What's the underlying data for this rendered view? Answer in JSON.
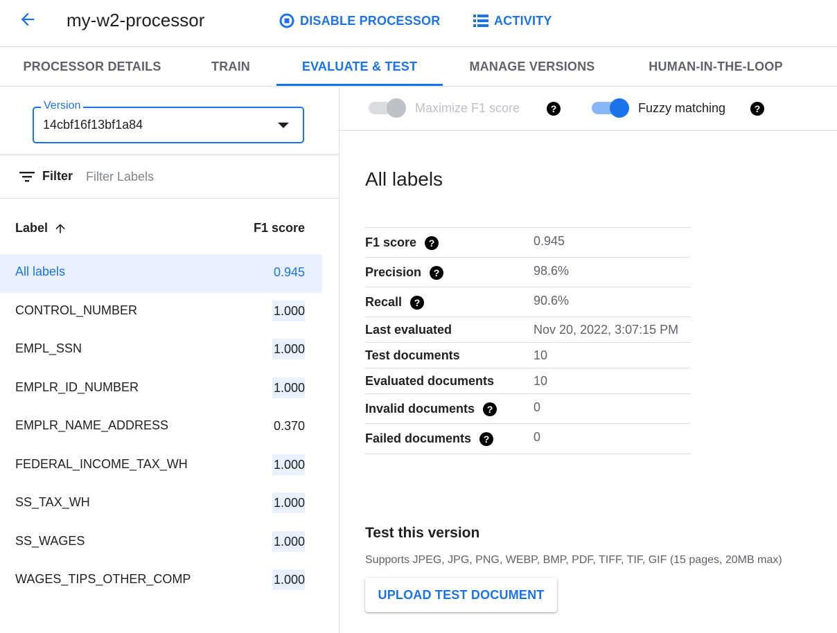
{
  "header": {
    "title": "my-w2-processor",
    "disable_label": "DISABLE PROCESSOR",
    "activity_label": "ACTIVITY"
  },
  "tabs": [
    {
      "label": "PROCESSOR DETAILS",
      "active": false
    },
    {
      "label": "TRAIN",
      "active": false
    },
    {
      "label": "EVALUATE & TEST",
      "active": true
    },
    {
      "label": "MANAGE VERSIONS",
      "active": false
    },
    {
      "label": "HUMAN-IN-THE-LOOP",
      "active": false
    }
  ],
  "version": {
    "label": "Version",
    "value": "14cbf16f13bf1a84"
  },
  "filter": {
    "label": "Filter",
    "placeholder": "Filter Labels"
  },
  "table": {
    "col_label": "Label",
    "col_score": "F1 score",
    "rows": [
      {
        "label": "All labels",
        "score": "0.945"
      },
      {
        "label": "CONTROL_NUMBER",
        "score": "1.000"
      },
      {
        "label": "EMPL_SSN",
        "score": "1.000"
      },
      {
        "label": "EMPLR_ID_NUMBER",
        "score": "1.000"
      },
      {
        "label": "EMPLR_NAME_ADDRESS",
        "score": "0.370"
      },
      {
        "label": "FEDERAL_INCOME_TAX_WH",
        "score": "1.000"
      },
      {
        "label": "SS_TAX_WH",
        "score": "1.000"
      },
      {
        "label": "SS_WAGES",
        "score": "1.000"
      },
      {
        "label": "WAGES_TIPS_OTHER_COMP",
        "score": "1.000"
      }
    ]
  },
  "toggles": {
    "maximize_f1": {
      "label": "Maximize F1 score",
      "on": false,
      "disabled": true
    },
    "fuzzy": {
      "label": "Fuzzy matching",
      "on": true,
      "disabled": false
    }
  },
  "summary": {
    "title": "All labels",
    "metrics": [
      {
        "label": "F1 score",
        "value": "0.945",
        "help": true
      },
      {
        "label": "Precision",
        "value": "98.6%",
        "help": true
      },
      {
        "label": "Recall",
        "value": "90.6%",
        "help": true
      },
      {
        "label": "Last evaluated",
        "value": "Nov 20, 2022, 3:07:15 PM",
        "help": false
      },
      {
        "label": "Test documents",
        "value": "10",
        "help": false
      },
      {
        "label": "Evaluated documents",
        "value": "10",
        "help": false
      },
      {
        "label": "Invalid documents",
        "value": "0",
        "help": true
      },
      {
        "label": "Failed documents",
        "value": "0",
        "help": true
      }
    ]
  },
  "test": {
    "title": "Test this version",
    "supports": "Supports JPEG, JPG, PNG, WEBP, BMP, PDF, TIFF, TIF, GIF (15 pages, 20MB max)",
    "upload_label": "UPLOAD TEST DOCUMENT"
  },
  "colors": {
    "accent": "#1a73e8",
    "selected_row_bg": "#e8f0fe",
    "divider": "#dadce0"
  },
  "icons": {
    "back": "arrow-back-icon",
    "disable": "stop-circle-icon",
    "activity": "list-icon",
    "filter": "filter-list-icon",
    "sort": "arrow-upward-icon",
    "dropdown": "caret-down-icon",
    "help": "help-circle-icon"
  }
}
